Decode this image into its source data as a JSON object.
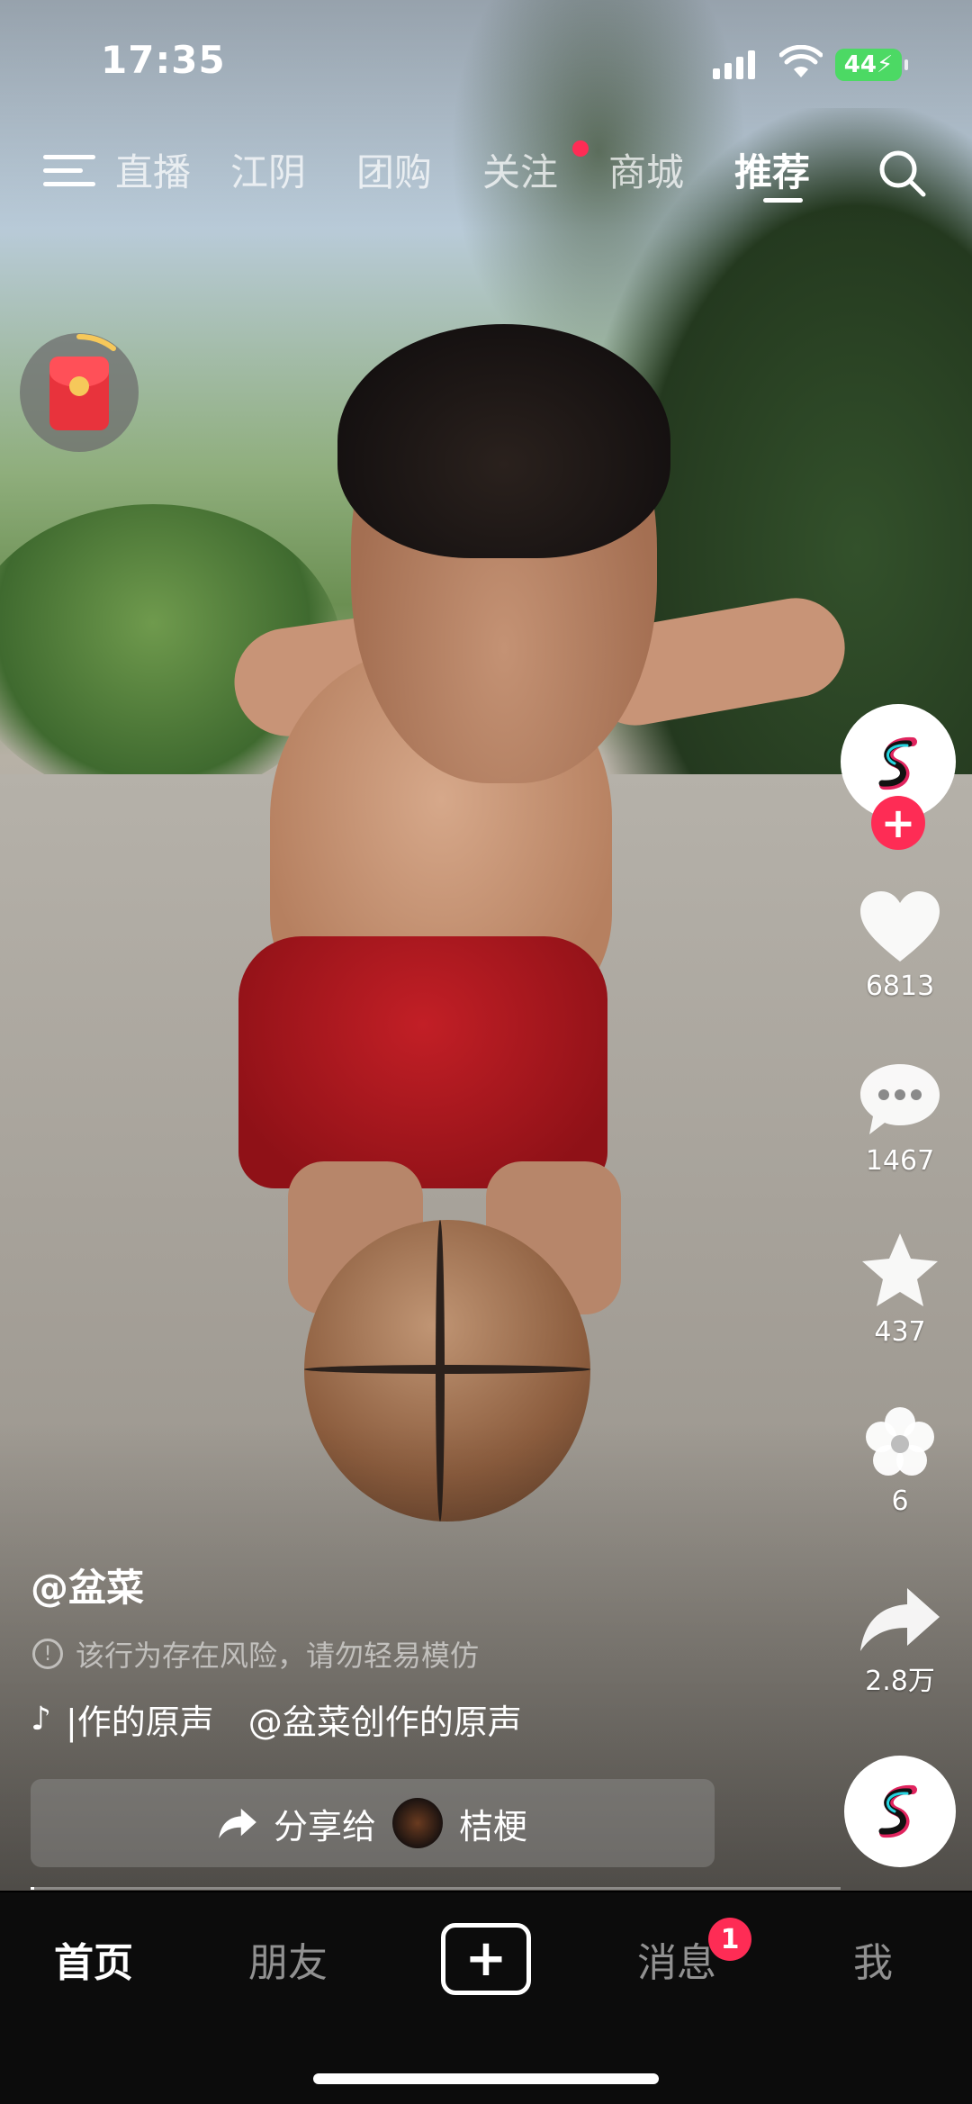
{
  "status_bar": {
    "time": "17:35",
    "battery": "44"
  },
  "top_nav": {
    "tabs": [
      {
        "label": "直播",
        "active": false
      },
      {
        "label": "江阴",
        "active": false
      },
      {
        "label": "团购",
        "active": false
      },
      {
        "label": "关注",
        "active": false,
        "has_dot": true
      },
      {
        "label": "商城",
        "active": false
      },
      {
        "label": "推荐",
        "active": true
      }
    ],
    "menu_icon": "hamburger-icon",
    "search_icon": "search-icon"
  },
  "right_rail": {
    "follow_icon": "plus-icon",
    "like_count": "6813",
    "comment_count": "1467",
    "favorite_count": "437",
    "recommend_count": "6",
    "share_count": "2.8万"
  },
  "caption": {
    "author": "@盆菜",
    "warning": "该行为存在风险，请勿轻易模仿",
    "music_text": "|作的原声　@盆菜创作的原声",
    "share_prefix": "分享给",
    "share_target": "桔梗"
  },
  "progress": {
    "fraction": 0.002
  },
  "tab_bar": {
    "home": "首页",
    "friends": "朋友",
    "create": "+",
    "messages": "消息",
    "messages_badge": "1",
    "me": "我"
  },
  "colors": {
    "accent": "#fe2c55",
    "battery": "#4cd964",
    "tabbar_bg": "#0c0c0c"
  }
}
